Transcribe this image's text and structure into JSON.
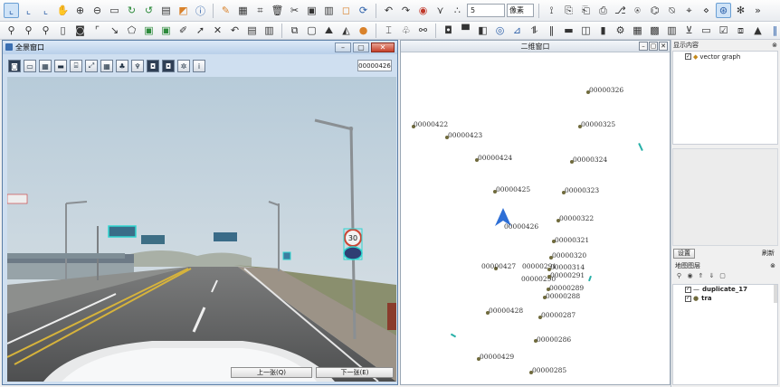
{
  "toolbar1": {
    "scale_value": "5",
    "unit_select": "像素",
    "icons": [
      "xy-axis-icon",
      "xy-axis2-icon",
      "xy-axis3-icon",
      "hand-icon",
      "zoom-in-icon",
      "zoom-out-icon",
      "extent-icon",
      "refresh-icon",
      "refresh2-icon",
      "layer-icon",
      "select-icon",
      "info-icon",
      "pen-icon",
      "grid-icon",
      "snap-icon",
      "delete-icon",
      "cut-icon",
      "merge-icon",
      "split-icon",
      "square-icon",
      "redo-loop-icon",
      "undo-icon",
      "redo-icon",
      "stop-icon",
      "vertex-icon"
    ]
  },
  "toolbar2": {
    "icons": [
      "pin-icon",
      "pin2-icon",
      "pin3-icon",
      "book-icon",
      "camera-icon",
      "frame-icon",
      "line-icon",
      "poly-icon",
      "image-icon",
      "image2-icon",
      "edit-icon",
      "arrow-icon",
      "close-x-icon",
      "undo-icon",
      "save-icon",
      "print-icon",
      "copy-icon",
      "rect-icon",
      "mountain-icon",
      "chart-icon",
      "dot-icon",
      "merge-icon",
      "group-icon",
      "tree-icon",
      "magnify-icon",
      "trash-icon",
      "frame2-icon",
      "globe-icon",
      "photo-icon",
      "layers-icon",
      "barcode-icon",
      "bars-icon",
      "box-icon",
      "lamp-icon",
      "gear-icon",
      "window-icon",
      "table-icon",
      "grid-icon",
      "print-icon",
      "triangle-icon",
      "bars2-icon"
    ]
  },
  "pano": {
    "title": "全景窗口",
    "image_id": "00000426",
    "prev_label": "上一张(Q)",
    "next_label": "下一张(E)",
    "speed_sign": "30",
    "tools": [
      "camera-icon",
      "view-icon",
      "image-icon",
      "road-icon",
      "tag-icon",
      "measure-icon",
      "grid-icon",
      "tree-icon",
      "signal-icon",
      "photo-icon",
      "photo2-icon",
      "gear-icon",
      "info-icon"
    ]
  },
  "map": {
    "title": "二维窗口",
    "points": [
      {
        "id": "00000326"
      },
      {
        "id": "00000422"
      },
      {
        "id": "00000423"
      },
      {
        "id": "00000325"
      },
      {
        "id": "00000424"
      },
      {
        "id": "00000324"
      },
      {
        "id": "00000425"
      },
      {
        "id": "00000323"
      },
      {
        "id": "00000322"
      },
      {
        "id": "00000426"
      },
      {
        "id": "00000321"
      },
      {
        "id": "00000320"
      },
      {
        "id": "00000427"
      },
      {
        "id": "00000291"
      },
      {
        "id": "00000314"
      },
      {
        "id": "00000290"
      },
      {
        "id": "00000291"
      },
      {
        "id": "00000289"
      },
      {
        "id": "00000288"
      },
      {
        "id": "00000428"
      },
      {
        "id": "00000287"
      },
      {
        "id": "00000286"
      },
      {
        "id": "00000429"
      },
      {
        "id": "00000285"
      }
    ]
  },
  "side": {
    "content_title": "显示内容",
    "pin_label": "⊗",
    "layer_name": "vector graph",
    "setup_label": "设置",
    "refresh_label": "刷新",
    "maplayer_title": "地图图层",
    "maplayers": [
      {
        "name": "duplicate_17",
        "checked": true
      },
      {
        "name": "tra",
        "checked": true
      }
    ]
  }
}
